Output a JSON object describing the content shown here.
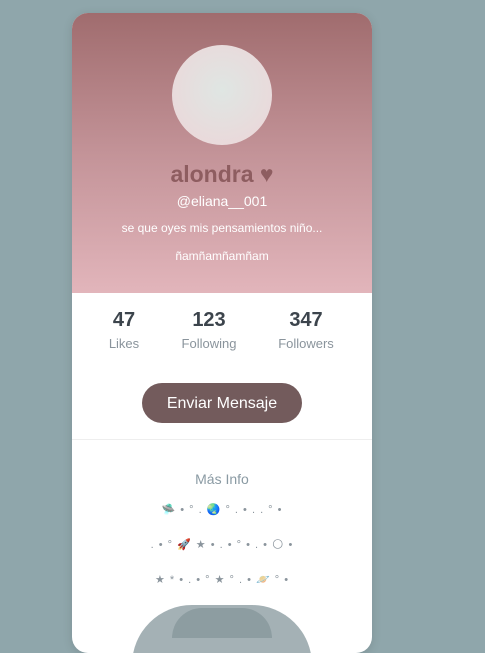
{
  "profile": {
    "name": "alondra ♥",
    "handle": "@eliana__001",
    "bio_line1": "se que oyes mis pensamientos niño...",
    "bio_line2": "ñamñamñamñam"
  },
  "stats": [
    {
      "value": "47",
      "label": "Likes"
    },
    {
      "value": "123",
      "label": "Following"
    },
    {
      "value": "347",
      "label": "Followers"
    }
  ],
  "actions": {
    "message_label": "Enviar Mensaje"
  },
  "more_info": {
    "title": "Más Info",
    "deco_line1": "🛸 • ° . 🌏   °  . • .  . ° •",
    "deco_line2": ".   •   ° 🚀 ★ • .   •   ° • . • 🌕  •",
    "deco_line3": "★   * •   .   •  °   ★   ° .   • 🪐 ° •"
  },
  "colors": {
    "background": "#8fa6ab",
    "header_top": "#a06c6e",
    "header_bottom": "#e2b5bb",
    "button": "#735b5c",
    "name": "#8e5d60"
  }
}
